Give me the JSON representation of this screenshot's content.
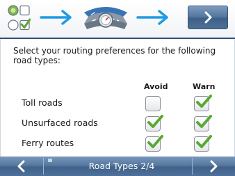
{
  "prompt": "Select your routing preferences for the following road types:",
  "columns": {
    "avoid": "Avoid",
    "warn": "Warn"
  },
  "rows": [
    {
      "label": "Toll roads",
      "avoid": false,
      "warn": true
    },
    {
      "label": "Unsurfaced roads",
      "avoid": true,
      "warn": true
    },
    {
      "label": "Ferry routes",
      "avoid": true,
      "warn": true
    }
  ],
  "footer": {
    "title": "Road Types 2/4"
  },
  "icons": {
    "options": "options-checkbox-radio-icon",
    "arrow": "right-arrow-icon",
    "road": "road-gauge-icon",
    "next": "chevron-right-icon",
    "back": "chevron-left-icon",
    "check": "green-check-icon"
  },
  "colors": {
    "accent": "#1e9be4",
    "bar": "#4e6f96",
    "check": "#58a832"
  }
}
